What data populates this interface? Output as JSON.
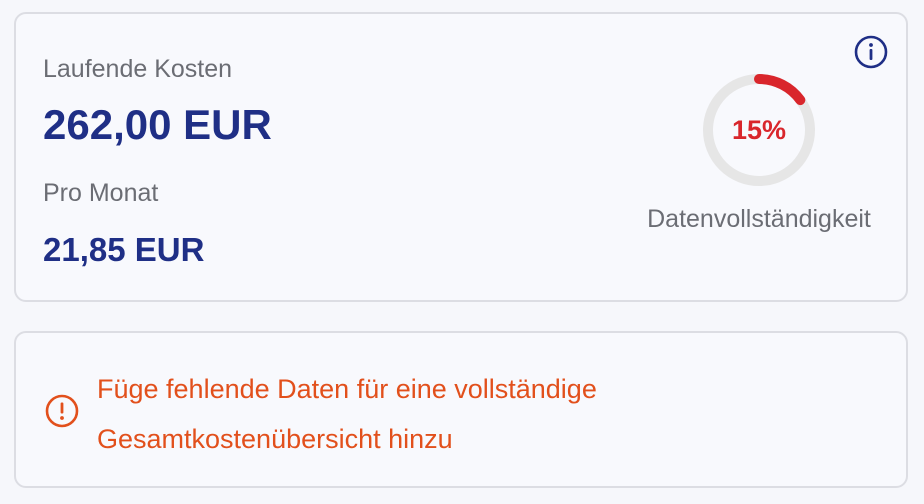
{
  "costs": {
    "running_label": "Laufende Kosten",
    "running_value": "262,00 EUR",
    "monthly_label": "Pro Monat",
    "monthly_value": "21,85 EUR"
  },
  "completeness": {
    "percent_text": "15%",
    "percent_value": 15,
    "caption": "Datenvollständigkeit",
    "progress_color": "#d9262c",
    "track_color": "#e6e6e6"
  },
  "icons": {
    "info": "info-circle-icon",
    "alert": "exclamation-circle-icon"
  },
  "alert": {
    "message": "Füge fehlende Daten für eine vollständige Gesamtkostenübersicht hinzu"
  },
  "colors": {
    "primary": "#1f2f86",
    "alert": "#e2501c",
    "muted_text": "#6b6d74"
  }
}
